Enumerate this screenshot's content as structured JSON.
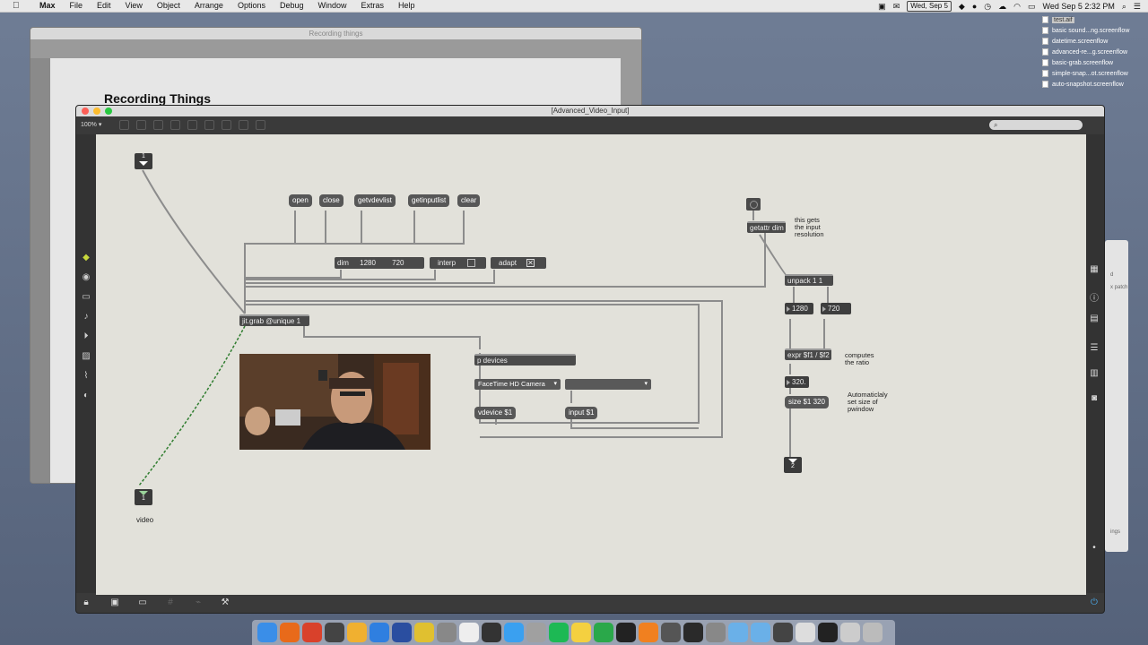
{
  "menubar": {
    "app": "Max",
    "items": [
      "File",
      "Edit",
      "View",
      "Object",
      "Arrange",
      "Options",
      "Debug",
      "Window",
      "Extras",
      "Help"
    ],
    "date_chip": "Wed, Sep 5",
    "clock": "Wed Sep 5  2:32 PM"
  },
  "desktop_files": [
    "test.aif",
    "basic sound...ng.screenflow",
    "datetime.screenflow",
    "advanced-re...g.screenflow",
    "basic-grab.screenflow",
    "simple-snap...ot.screenflow",
    "auto-snapshot.screenflow"
  ],
  "bg_window": {
    "title": "Recording things",
    "heading": "Recording Things"
  },
  "right_window": {
    "frag1": "d",
    "frag2": "x patch",
    "frag3": "ings"
  },
  "main_window": {
    "title": "[Advanced_Video_Input]",
    "zoom": "100%",
    "search_placeholder": ""
  },
  "patch": {
    "inlet_1": "1",
    "outlet_1": "1",
    "outlet_2": "2",
    "outlet_label": "video",
    "messages": {
      "open": "open",
      "close": "close",
      "getvdevlist": "getvdevlist",
      "getinputlist": "getinputlist",
      "clear": "clear",
      "vdevice": "vdevice $1",
      "input": "input $1",
      "size": "size $1 320"
    },
    "attrui": {
      "dim_label": "dim",
      "dim_w": "1280",
      "dim_h": "720",
      "interp_label": "interp",
      "adapt_label": "adapt"
    },
    "objects": {
      "jitgrab": "jit.grab @unique 1",
      "pdevices": "p devices",
      "getattr": "getattr dim",
      "unpack": "unpack 1 1",
      "expr": "expr $f1 / $f2"
    },
    "numbers": {
      "width": "1280",
      "height": "720",
      "ratio": "320."
    },
    "menus": {
      "device": "FaceTime HD Camera",
      "input": ""
    },
    "comments": {
      "getattr_note": [
        "this gets",
        "the input",
        "resolution"
      ],
      "ratio_note": [
        "computes",
        "the ratio"
      ],
      "size_note": [
        "Automaticlaly",
        "set size of",
        "pwindow"
      ]
    }
  }
}
